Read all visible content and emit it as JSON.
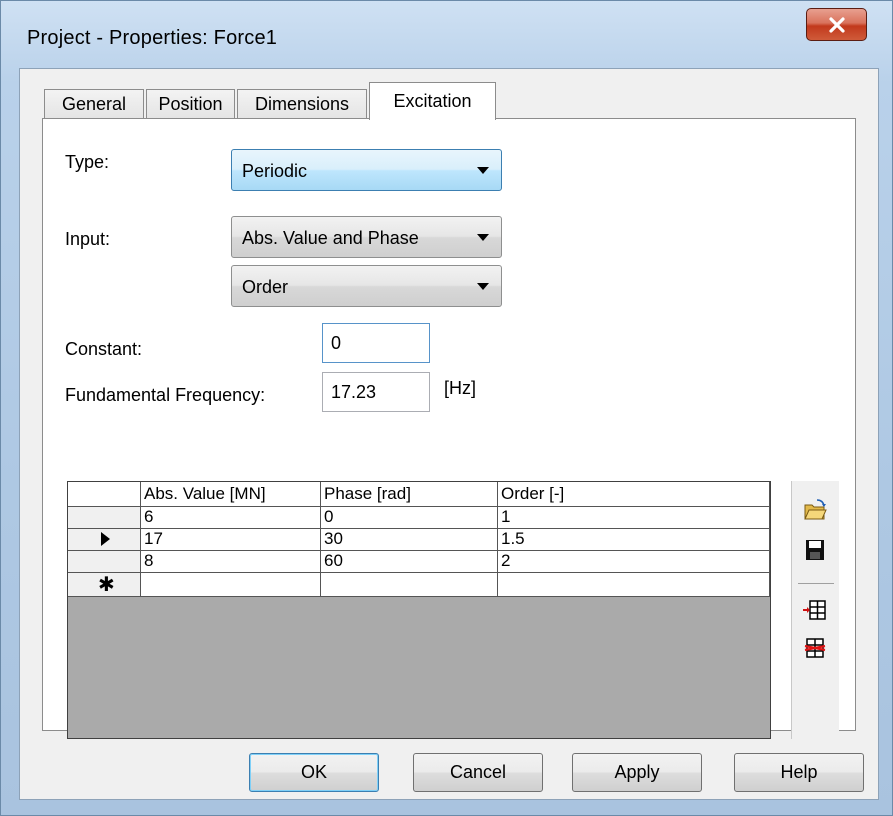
{
  "window": {
    "title": "Project - Properties: Force1",
    "close_label": "X"
  },
  "tabs": [
    {
      "label": "General",
      "active": false
    },
    {
      "label": "Position",
      "active": false
    },
    {
      "label": "Dimensions",
      "active": false
    },
    {
      "label": "Excitation",
      "active": true
    }
  ],
  "form": {
    "type_label": "Type:",
    "type_value": "Periodic",
    "input_label": "Input:",
    "input_value": "Abs. Value and Phase",
    "input_mode_value": "Order",
    "constant_label": "Constant:",
    "constant_value": "0",
    "frequency_label": "Fundamental Frequency:",
    "frequency_value": "17.23",
    "frequency_unit": "[Hz]"
  },
  "grid": {
    "columns": [
      "Abs. Value [MN]",
      "Phase [rad]",
      "Order [-]"
    ],
    "rows": [
      {
        "indicator": "",
        "cells": [
          "6",
          "0",
          "1"
        ]
      },
      {
        "indicator": "current",
        "cells": [
          "17",
          "30",
          "1.5"
        ]
      },
      {
        "indicator": "",
        "cells": [
          "8",
          "60",
          "2"
        ]
      },
      {
        "indicator": "new",
        "cells": [
          "",
          "",
          ""
        ]
      }
    ]
  },
  "toolbar": {
    "icons": [
      "open-folder-icon",
      "save-icon",
      "insert-row-icon",
      "delete-row-icon"
    ]
  },
  "buttons": {
    "ok": "OK",
    "cancel": "Cancel",
    "apply": "Apply",
    "help": "Help"
  },
  "colors": {
    "frame": "#aec8e3",
    "close_button": "#c2391c",
    "focus_border": "#3c7fb1"
  }
}
